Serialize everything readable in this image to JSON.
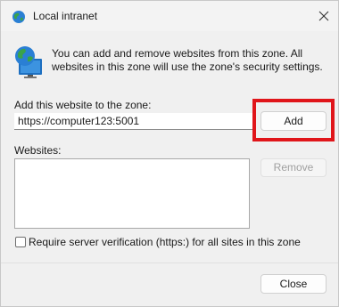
{
  "window": {
    "title": "Local intranet"
  },
  "info": {
    "text": "You can add and remove websites from this zone. All websites in this zone will use the zone's security settings."
  },
  "add_section": {
    "label": "Add this website to the zone:",
    "url_value": "https://computer123:5001",
    "add_button_label": "Add"
  },
  "websites_section": {
    "label": "Websites:",
    "remove_button_label": "Remove",
    "items": []
  },
  "options": {
    "require_verification_label": "Require server verification (https:) for all sites in this zone",
    "require_verification_checked": false
  },
  "footer": {
    "close_button_label": "Close"
  },
  "colors": {
    "highlight": "#e0151a",
    "globe_blue": "#2a7fd4",
    "globe_green": "#3aa34a"
  }
}
